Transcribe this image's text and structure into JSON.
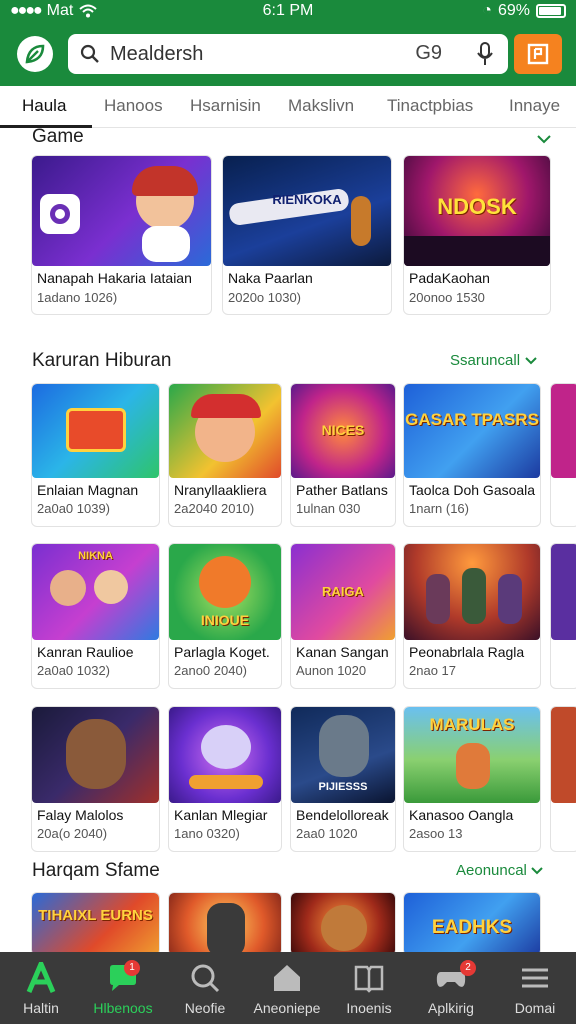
{
  "status_bar": {
    "carrier": "Mat",
    "time": "6:1 PM",
    "battery": "69%"
  },
  "search": {
    "placeholder": "Mealdersh",
    "scan_label": "G9"
  },
  "tabs": [
    {
      "label": "Haula",
      "active": true
    },
    {
      "label": "Hanoos"
    },
    {
      "label": "Hsarnisin"
    },
    {
      "label": "Makslivn"
    },
    {
      "label": "Tinactpbias"
    },
    {
      "label": "Innaye"
    }
  ],
  "sections": {
    "game": {
      "title": "Game",
      "cards": [
        {
          "title": "Nanapah Hakaria Iataian",
          "meta": "1adano 1026)",
          "art": ""
        },
        {
          "title": "Naka Paarlan",
          "meta": "2020o 1030)",
          "art": "RIENKOKA"
        },
        {
          "title": "PadaKaohan",
          "meta": "20onoo 1530",
          "art": "NDOSK"
        }
      ]
    },
    "hiburan": {
      "title": "Karuran Hiburan",
      "see_all": "Ssaruncall",
      "rows": [
        [
          {
            "title": "Enlaian Magnan",
            "meta": "2a0a0 1039)",
            "art": ""
          },
          {
            "title": "Nranyllaakliera",
            "meta": "2a2040 2010)",
            "art": ""
          },
          {
            "title": "Pather Batlans",
            "meta": "1ulnan 030",
            "art": "NICES"
          },
          {
            "title": "Taolca Doh Gasoala",
            "meta": "1narn (16)",
            "art": "GASAR TPASRS"
          }
        ],
        [
          {
            "title": "Kanran Raulioe",
            "meta": "2a0a0 1032)",
            "art": "NIKNA"
          },
          {
            "title": "Parlagla Koget.",
            "meta": "2ano0 2040)",
            "art": "INIOUE"
          },
          {
            "title": "Kanan Sangan",
            "meta": "Aunon 1020",
            "art": "RAIGA"
          },
          {
            "title": "Peonabrlala Ragla",
            "meta": "2nao 17",
            "art": ""
          }
        ],
        [
          {
            "title": "Falay Malolos",
            "meta": "20a(o 2040)",
            "art": ""
          },
          {
            "title": "Kanlan Mlegiar",
            "meta": "1ano 0320)",
            "art": ""
          },
          {
            "title": "Bendelolloreak",
            "meta": "2aa0 1020",
            "art": "PIJIESSS"
          },
          {
            "title": "Kanasoo Oangla",
            "meta": "2asoo 13",
            "art": "MARULAS"
          }
        ]
      ]
    },
    "harqam": {
      "title": "Harqam Sfame",
      "see_all": "Aeonuncal",
      "cards": [
        {
          "art": "TIHAIXL EURNS"
        },
        {
          "art": ""
        },
        {
          "art": ""
        },
        {
          "art": "EADHKS"
        }
      ]
    }
  },
  "bottom_nav": [
    {
      "label": "Haltin",
      "icon": "home-a-icon",
      "active": false
    },
    {
      "label": "Hlbenoos",
      "icon": "chat-icon",
      "active": true,
      "badge": "1"
    },
    {
      "label": "Neofie",
      "icon": "search-icon"
    },
    {
      "label": "Aneoniepe",
      "icon": "house-icon"
    },
    {
      "label": "Inoenis",
      "icon": "book-icon"
    },
    {
      "label": "Aplkirig",
      "icon": "gamepad-icon",
      "badge": "2"
    },
    {
      "label": "Domai",
      "icon": "menu-icon"
    }
  ],
  "colors": {
    "brand_green": "#1a8a3c",
    "accent_orange": "#f5821f",
    "nav_bg": "#3a3a3a"
  }
}
